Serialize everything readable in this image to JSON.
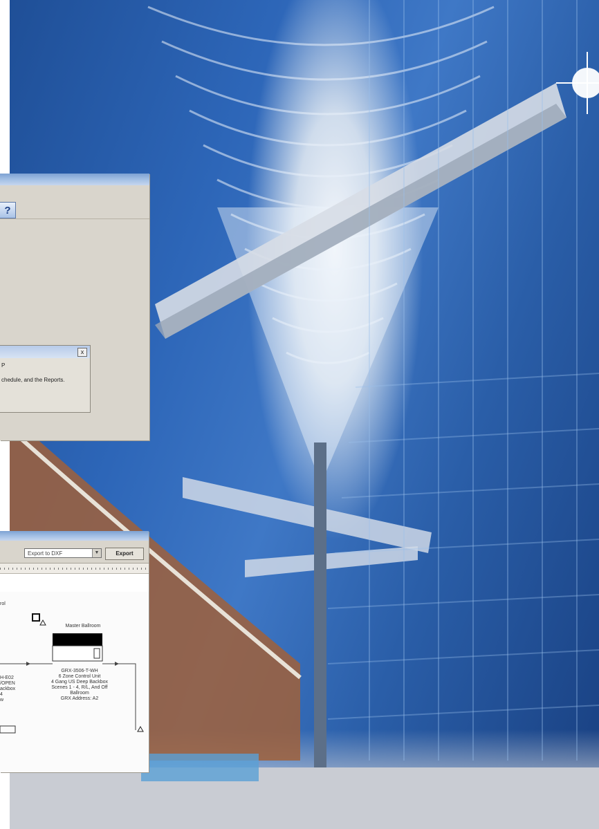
{
  "window_top": {
    "help_icon": "?",
    "dialog": {
      "close_icon": "x",
      "line_1": "P",
      "line_2": "chedule, and the Reports."
    }
  },
  "window_bottom": {
    "export_select": {
      "value": "Export to DXF",
      "arrow_icon": "▼"
    },
    "export_button": "Export",
    "diagram": {
      "label_left_top": "rol",
      "room_title": "Master Ballroom",
      "device_lines": [
        "GRX-3506-T-WH",
        "6 Zone Control Unit",
        "4 Gang US Deep Backbox",
        "Scenes 1 - 4, R/L, And Off",
        "Ballroom",
        "GRX Address: A2"
      ],
      "left_lines": [
        "H-E02",
        "/OPEN",
        "ackbox",
        "4",
        "w"
      ]
    }
  }
}
